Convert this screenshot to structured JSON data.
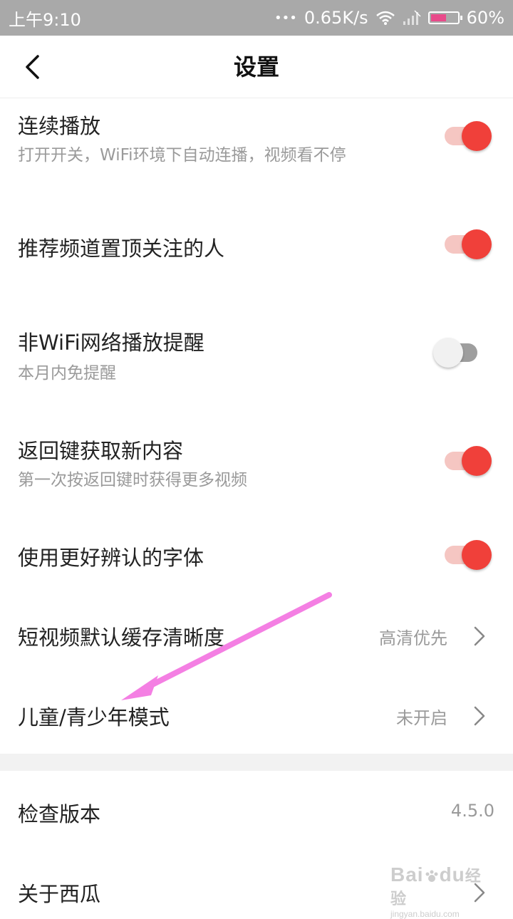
{
  "status": {
    "time": "上午9:10",
    "dots": "•••",
    "network_speed": "0.65K/s",
    "battery": "60%",
    "battery_level": 0.6,
    "icons": [
      "wifi-icon",
      "signal-icon",
      "battery-icon"
    ]
  },
  "nav": {
    "title": "设置",
    "back_icon": "back-chevron-icon"
  },
  "settings": {
    "autoplay": {
      "title": "连续播放",
      "subtitle": "打开开关，WiFi环境下自动连播，视频看不停",
      "enabled": true
    },
    "pin_followed": {
      "title": "推荐频道置顶关注的人",
      "enabled": true
    },
    "non_wifi": {
      "title": "非WiFi网络播放提醒",
      "subtitle": "本月内免提醒",
      "enabled": false
    },
    "back_key": {
      "title": "返回键获取新内容",
      "subtitle": "第一次按返回键时获得更多视频",
      "enabled": true
    },
    "better_font": {
      "title": "使用更好辨认的字体",
      "enabled": true
    },
    "cache_quality": {
      "title": "短视频默认缓存清晰度",
      "value": "高清优先"
    },
    "youth_mode": {
      "title": "儿童/青少年模式",
      "value": "未开启"
    },
    "check_version": {
      "title": "检查版本",
      "value": "4.5.0"
    },
    "about": {
      "title": "关于西瓜"
    }
  },
  "colors": {
    "accent": "#f0403a",
    "accent_track": "#f5c6c2",
    "annotation_arrow": "#f47fe3"
  },
  "watermark": {
    "brand": "Bai",
    "brand2": "du",
    "suffix": "经验",
    "url": "jingyan.baidu.com"
  }
}
